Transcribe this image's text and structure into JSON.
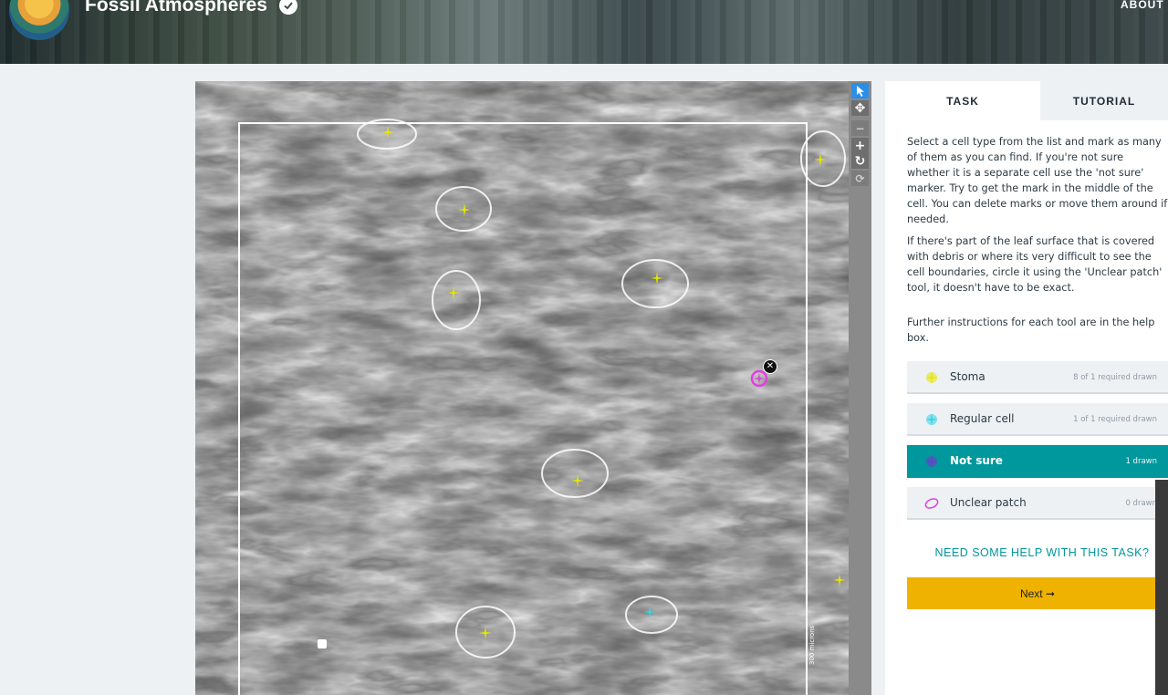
{
  "header": {
    "project_title": "Fossil Atmospheres",
    "nav_about": "ABOUT"
  },
  "subject": {
    "scale_label": "300 microns"
  },
  "tabs": {
    "task": "TASK",
    "tutorial": "TUTORIAL"
  },
  "instructions": [
    "Select a cell type from the list and mark as many of them as you can find. If you're not sure whether it is a separate cell use the 'not sure' marker. Try to get the mark in the middle of the cell. You can delete marks or move them around if needed.",
    "If there's part of the leaf surface that is covered with debris or where its very difficult to see the cell boundaries, circle it using the 'Unclear patch' tool, it doesn't have to be exact.",
    "Further instructions for each tool are in the help box."
  ],
  "tools": [
    {
      "label": "Stoma",
      "count": "8 of 1 required drawn",
      "color": "#e6e600",
      "icon": "stoma-marker-icon"
    },
    {
      "label": "Regular cell",
      "count": "1 of 1 required drawn",
      "color": "#33d6e6",
      "icon": "regular-cell-marker-icon"
    },
    {
      "label": "Not sure",
      "count": "1 drawn",
      "color": "#6a3fc9",
      "icon": "not-sure-marker-icon"
    },
    {
      "label": "Unclear patch",
      "count": "0 drawn",
      "color": "#e040e0",
      "icon": "ellipse-icon"
    }
  ],
  "help_link": "NEED SOME HELP WITH THIS TASK?",
  "next_button": "Next ➞",
  "colors": {
    "accent_teal": "#00979d",
    "next_yellow": "#f0b200",
    "toolbar_active": "#2b8ee8"
  }
}
